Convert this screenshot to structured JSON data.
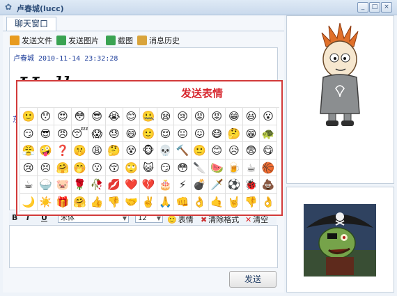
{
  "window": {
    "title": "卢春城(lucc)",
    "buttons": [
      "_",
      "□",
      "×"
    ]
  },
  "tabs": [
    {
      "label": "聊天窗口"
    }
  ],
  "toolbar": {
    "send_file": "发送文件",
    "send_image": "发送图片",
    "screenshot": "截图",
    "history": "消息历史"
  },
  "message": {
    "sender": "卢春城",
    "time": "2010-11-14 23:32:28",
    "text": "Hello",
    "partial": "东"
  },
  "emoji_panel": {
    "label": "发送表情",
    "emojis": [
      "🙂",
      "😯",
      "😍",
      "😳",
      "😎",
      "😭",
      "😊",
      "🤐",
      "😪",
      "😢",
      "😡",
      "😡",
      "😁",
      "😃",
      "😮",
      "😏",
      "😎",
      "😠",
      "😴",
      "😱",
      "😓",
      "😄",
      "🙂",
      "😌",
      "😐",
      "😖",
      "😷",
      "🤔",
      "😁",
      "🐢",
      "😤",
      "🤪",
      "❓",
      "🤫",
      "😩",
      "🤔",
      "😵",
      "🐵",
      "💀",
      "🔨",
      "🙂",
      "😊",
      "😥",
      "😨",
      "😋",
      "😢",
      "😣",
      "🤗",
      "🤭",
      "😗",
      "😚",
      "🙄",
      "😺",
      "😏",
      "😳",
      "🔪",
      "🍉",
      "🍺",
      "☕",
      "🏀",
      "☕",
      "🍚",
      "🐷",
      "🌹",
      "🥀",
      "💋",
      "❤️",
      "💔",
      "🎂",
      "⚡",
      "💣",
      "🗡️",
      "⚽",
      "🐞",
      "💩",
      "🌙",
      "☀️",
      "🎁",
      "🤗",
      "👍",
      "👎",
      "🤝",
      "✌️",
      "🙏",
      "👊",
      "👌",
      "🤙",
      "🤘",
      "👎",
      "👌"
    ]
  },
  "format_bar": {
    "bold": "B",
    "italic": "I",
    "underline": "U",
    "font": "宋体",
    "size": "12",
    "emoji": "表情",
    "clear_format": "清除格式",
    "clear": "清空"
  },
  "send_button": "发送",
  "colors": {
    "highlight_border": "#d23a3a",
    "highlight_text": "#d7282f",
    "sender": "#1f3f9b"
  }
}
